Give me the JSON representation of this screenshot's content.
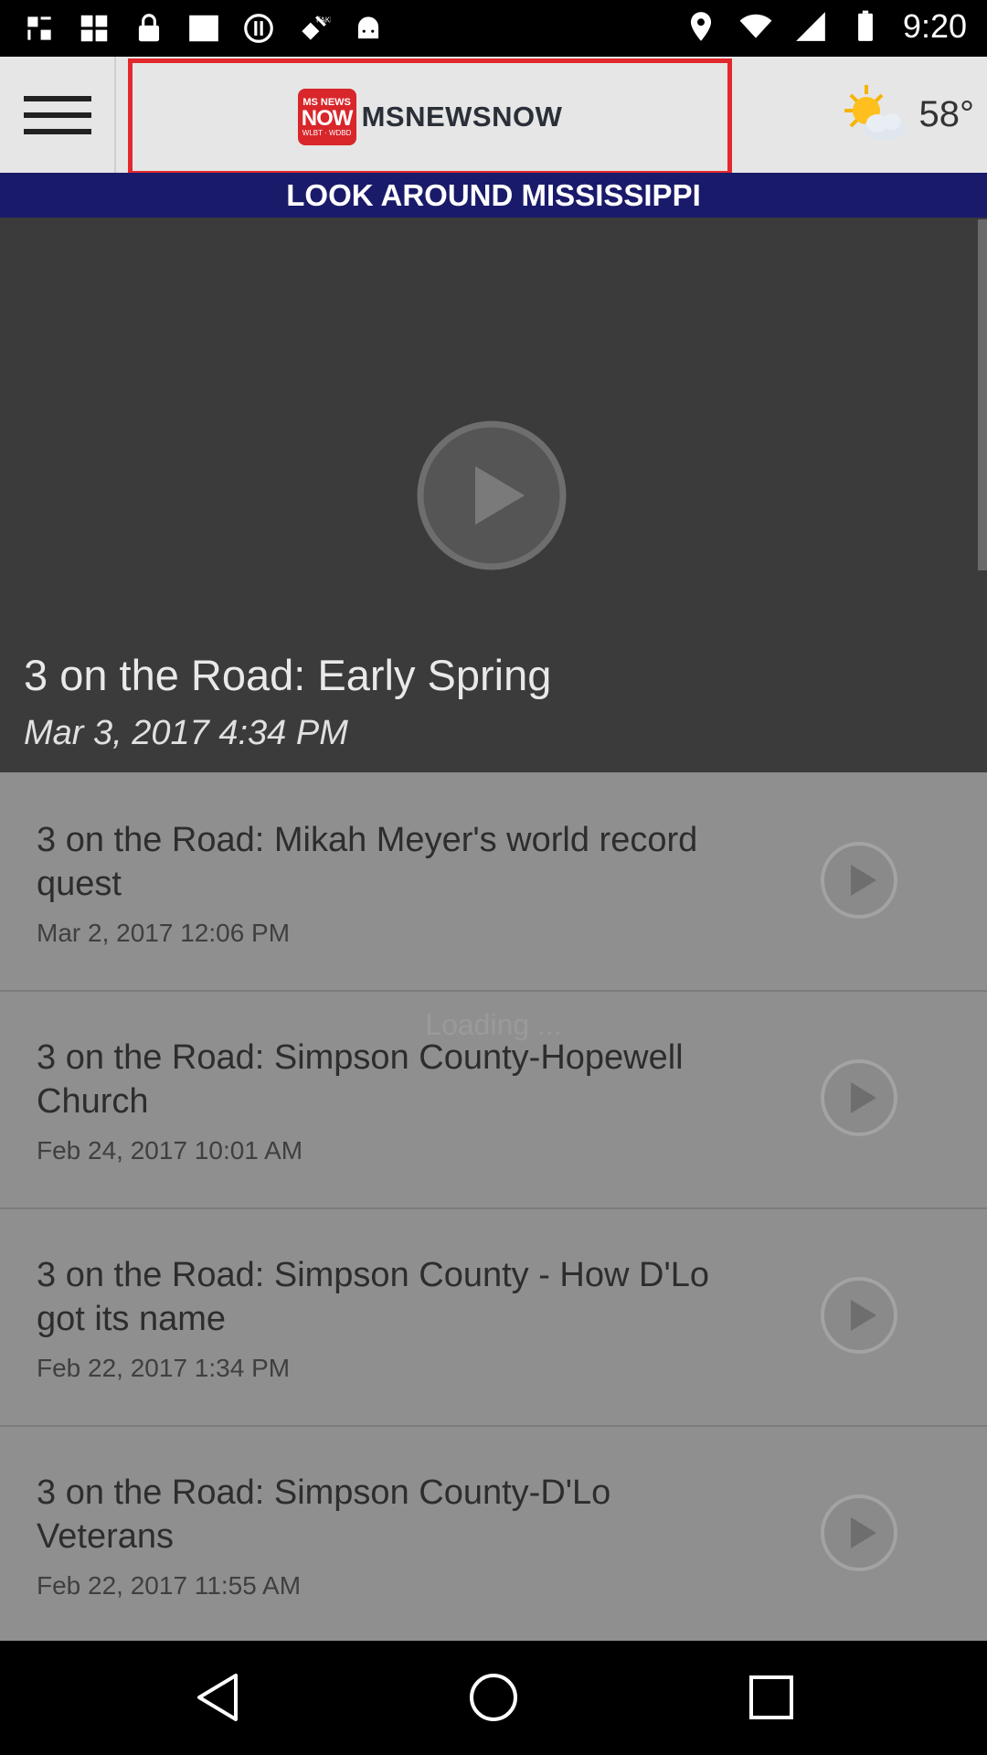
{
  "status_bar": {
    "time": "9:20",
    "icons_left": [
      "download-icon",
      "grid-icon",
      "lock-icon",
      "square-icon",
      "mystery-icon",
      "satellite-icon",
      "android-icon"
    ],
    "icons_right": [
      "location-icon",
      "wifi-icon",
      "signal-icon",
      "battery-icon"
    ]
  },
  "header": {
    "menu_icon": "hamburger-menu-icon",
    "logo_badge": {
      "line1": "MS NEWS",
      "line2": "NOW",
      "line3": "WLBT · WDBD"
    },
    "brand": "MSNEWSNOW",
    "weather_icon": "partly-sunny-icon",
    "temperature": "58°"
  },
  "banner": "LOOK AROUND MISSISSIPPI",
  "featured": {
    "title": "3 on the Road: Early Spring",
    "date": "Mar 3, 2017 4:34 PM"
  },
  "loading_text": "Loading ...",
  "videos": [
    {
      "title": "3 on the Road: Mikah Meyer's world record quest",
      "date": "Mar 2, 2017 12:06 PM"
    },
    {
      "title": "3 on the Road: Simpson County-Hopewell Church",
      "date": "Feb 24, 2017 10:01 AM"
    },
    {
      "title": "3 on the Road: Simpson County - How D'Lo got its name",
      "date": "Feb 22, 2017 1:34 PM"
    },
    {
      "title": "3 on the Road: Simpson County-D'Lo Veterans",
      "date": "Feb 22, 2017 11:55 AM"
    }
  ],
  "colors": {
    "banner": "#1a1a6b",
    "highlight_box": "#e3282c",
    "logo_red": "#d8262b"
  }
}
